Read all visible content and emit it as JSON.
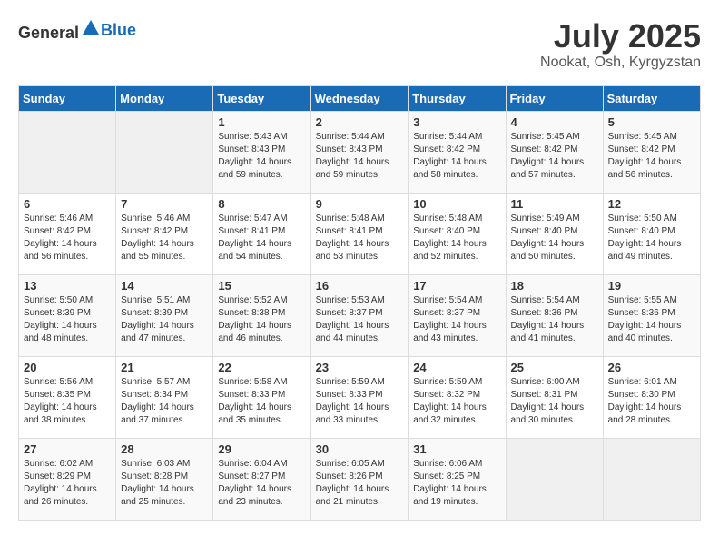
{
  "header": {
    "logo_general": "General",
    "logo_blue": "Blue",
    "month": "July 2025",
    "location": "Nookat, Osh, Kyrgyzstan"
  },
  "columns": [
    "Sunday",
    "Monday",
    "Tuesday",
    "Wednesday",
    "Thursday",
    "Friday",
    "Saturday"
  ],
  "weeks": [
    [
      {
        "day": "",
        "empty": true
      },
      {
        "day": "",
        "empty": true
      },
      {
        "day": "1",
        "sunrise": "5:43 AM",
        "sunset": "8:43 PM",
        "daylight": "14 hours and 59 minutes."
      },
      {
        "day": "2",
        "sunrise": "5:44 AM",
        "sunset": "8:43 PM",
        "daylight": "14 hours and 59 minutes."
      },
      {
        "day": "3",
        "sunrise": "5:44 AM",
        "sunset": "8:42 PM",
        "daylight": "14 hours and 58 minutes."
      },
      {
        "day": "4",
        "sunrise": "5:45 AM",
        "sunset": "8:42 PM",
        "daylight": "14 hours and 57 minutes."
      },
      {
        "day": "5",
        "sunrise": "5:45 AM",
        "sunset": "8:42 PM",
        "daylight": "14 hours and 56 minutes."
      }
    ],
    [
      {
        "day": "6",
        "sunrise": "5:46 AM",
        "sunset": "8:42 PM",
        "daylight": "14 hours and 56 minutes."
      },
      {
        "day": "7",
        "sunrise": "5:46 AM",
        "sunset": "8:42 PM",
        "daylight": "14 hours and 55 minutes."
      },
      {
        "day": "8",
        "sunrise": "5:47 AM",
        "sunset": "8:41 PM",
        "daylight": "14 hours and 54 minutes."
      },
      {
        "day": "9",
        "sunrise": "5:48 AM",
        "sunset": "8:41 PM",
        "daylight": "14 hours and 53 minutes."
      },
      {
        "day": "10",
        "sunrise": "5:48 AM",
        "sunset": "8:40 PM",
        "daylight": "14 hours and 52 minutes."
      },
      {
        "day": "11",
        "sunrise": "5:49 AM",
        "sunset": "8:40 PM",
        "daylight": "14 hours and 50 minutes."
      },
      {
        "day": "12",
        "sunrise": "5:50 AM",
        "sunset": "8:40 PM",
        "daylight": "14 hours and 49 minutes."
      }
    ],
    [
      {
        "day": "13",
        "sunrise": "5:50 AM",
        "sunset": "8:39 PM",
        "daylight": "14 hours and 48 minutes."
      },
      {
        "day": "14",
        "sunrise": "5:51 AM",
        "sunset": "8:39 PM",
        "daylight": "14 hours and 47 minutes."
      },
      {
        "day": "15",
        "sunrise": "5:52 AM",
        "sunset": "8:38 PM",
        "daylight": "14 hours and 46 minutes."
      },
      {
        "day": "16",
        "sunrise": "5:53 AM",
        "sunset": "8:37 PM",
        "daylight": "14 hours and 44 minutes."
      },
      {
        "day": "17",
        "sunrise": "5:54 AM",
        "sunset": "8:37 PM",
        "daylight": "14 hours and 43 minutes."
      },
      {
        "day": "18",
        "sunrise": "5:54 AM",
        "sunset": "8:36 PM",
        "daylight": "14 hours and 41 minutes."
      },
      {
        "day": "19",
        "sunrise": "5:55 AM",
        "sunset": "8:36 PM",
        "daylight": "14 hours and 40 minutes."
      }
    ],
    [
      {
        "day": "20",
        "sunrise": "5:56 AM",
        "sunset": "8:35 PM",
        "daylight": "14 hours and 38 minutes."
      },
      {
        "day": "21",
        "sunrise": "5:57 AM",
        "sunset": "8:34 PM",
        "daylight": "14 hours and 37 minutes."
      },
      {
        "day": "22",
        "sunrise": "5:58 AM",
        "sunset": "8:33 PM",
        "daylight": "14 hours and 35 minutes."
      },
      {
        "day": "23",
        "sunrise": "5:59 AM",
        "sunset": "8:33 PM",
        "daylight": "14 hours and 33 minutes."
      },
      {
        "day": "24",
        "sunrise": "5:59 AM",
        "sunset": "8:32 PM",
        "daylight": "14 hours and 32 minutes."
      },
      {
        "day": "25",
        "sunrise": "6:00 AM",
        "sunset": "8:31 PM",
        "daylight": "14 hours and 30 minutes."
      },
      {
        "day": "26",
        "sunrise": "6:01 AM",
        "sunset": "8:30 PM",
        "daylight": "14 hours and 28 minutes."
      }
    ],
    [
      {
        "day": "27",
        "sunrise": "6:02 AM",
        "sunset": "8:29 PM",
        "daylight": "14 hours and 26 minutes."
      },
      {
        "day": "28",
        "sunrise": "6:03 AM",
        "sunset": "8:28 PM",
        "daylight": "14 hours and 25 minutes."
      },
      {
        "day": "29",
        "sunrise": "6:04 AM",
        "sunset": "8:27 PM",
        "daylight": "14 hours and 23 minutes."
      },
      {
        "day": "30",
        "sunrise": "6:05 AM",
        "sunset": "8:26 PM",
        "daylight": "14 hours and 21 minutes."
      },
      {
        "day": "31",
        "sunrise": "6:06 AM",
        "sunset": "8:25 PM",
        "daylight": "14 hours and 19 minutes."
      },
      {
        "day": "",
        "empty": true
      },
      {
        "day": "",
        "empty": true
      }
    ]
  ]
}
